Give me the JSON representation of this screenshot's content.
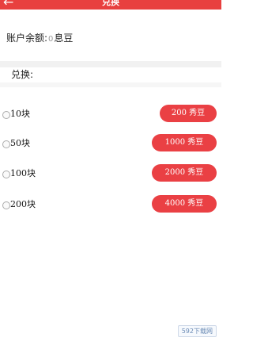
{
  "header": {
    "title": "兑换",
    "back_icon": "arrow-left-icon"
  },
  "balance": {
    "label": "账户余额:",
    "value": "0",
    "unit": "息豆"
  },
  "exchange": {
    "label": "兑换:",
    "options": [
      {
        "amount": "10块",
        "price": "200 秀豆"
      },
      {
        "amount": "50块",
        "price": "1000 秀豆"
      },
      {
        "amount": "100块",
        "price": "2000 秀豆"
      },
      {
        "amount": "200块",
        "price": "4000 秀豆"
      }
    ]
  },
  "watermark": "592下载网",
  "colors": {
    "accent": "#e8403f",
    "button": "#ea4044"
  }
}
